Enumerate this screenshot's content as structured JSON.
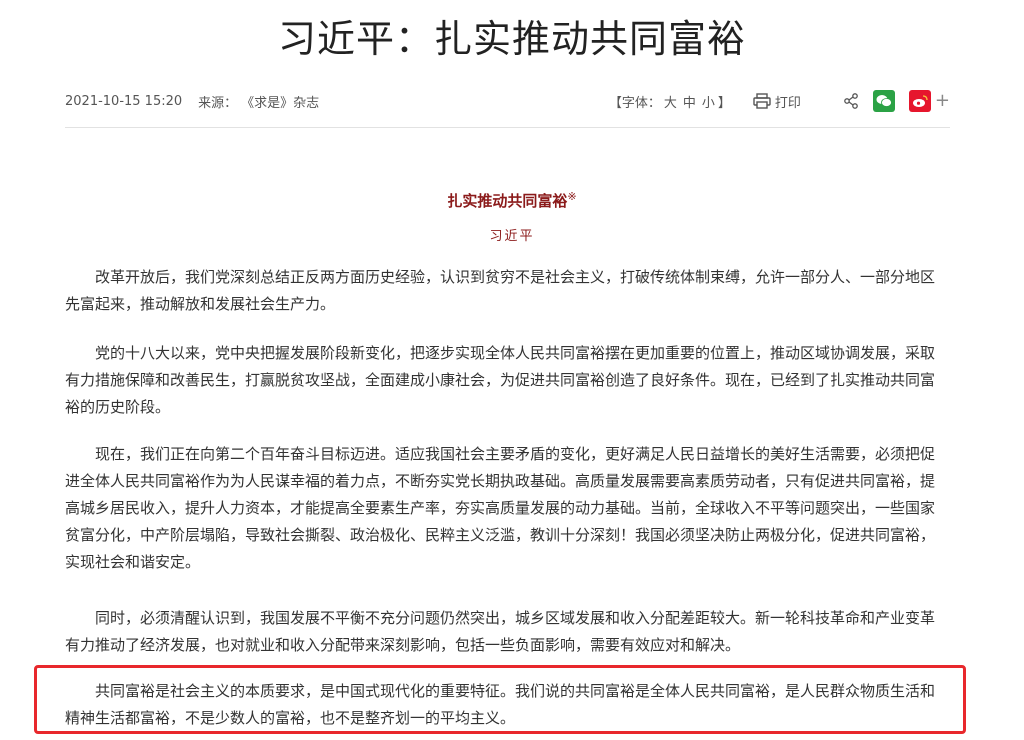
{
  "header": {
    "headline": "习近平：扎实推动共同富裕",
    "date": "2021-10-15 15:20",
    "source_label": "来源：",
    "source": "《求是》杂志",
    "font_bracket_open": "【字体：",
    "font_large": "大",
    "font_medium": "中",
    "font_small": "小",
    "font_bracket_close": "】",
    "print_label": "打印",
    "plus": "+"
  },
  "article": {
    "title": "扎实推动共同富裕",
    "title_mark": "※",
    "author": "习近平",
    "paragraphs": [
      "改革开放后，我们党深刻总结正反两方面历史经验，认识到贫穷不是社会主义，打破传统体制束缚，允许一部分人、一部分地区先富起来，推动解放和发展社会生产力。",
      "党的十八大以来，党中央把握发展阶段新变化，把逐步实现全体人民共同富裕摆在更加重要的位置上，推动区域协调发展，采取有力措施保障和改善民生，打赢脱贫攻坚战，全面建成小康社会，为促进共同富裕创造了良好条件。现在，已经到了扎实推动共同富裕的历史阶段。",
      "现在，我们正在向第二个百年奋斗目标迈进。适应我国社会主要矛盾的变化，更好满足人民日益增长的美好生活需要，必须把促进全体人民共同富裕作为为人民谋幸福的着力点，不断夯实党长期执政基础。高质量发展需要高素质劳动者，只有促进共同富裕，提高城乡居民收入，提升人力资本，才能提高全要素生产率，夯实高质量发展的动力基础。当前，全球收入不平等问题突出，一些国家贫富分化，中产阶层塌陷，导致社会撕裂、政治极化、民粹主义泛滥，教训十分深刻！我国必须坚决防止两极分化，促进共同富裕，实现社会和谐安定。",
      "同时，必须清醒认识到，我国发展不平衡不充分问题仍然突出，城乡区域发展和收入分配差距较大。新一轮科技革命和产业变革有力推动了经济发展，也对就业和收入分配带来深刻影响，包括一些负面影响，需要有效应对和解决。",
      "共同富裕是社会主义的本质要求，是中国式现代化的重要特征。我们说的共同富裕是全体人民共同富裕，是人民群众物质生活和精神生活都富裕，不是少数人的富裕，也不是整齐划一的平均主义。"
    ]
  },
  "icons": [
    "printer-icon",
    "share-icon",
    "wechat-icon",
    "weibo-icon",
    "plus-icon"
  ],
  "colors": {
    "title_red": "#8b1a1a",
    "wechat_green": "#2ba245",
    "weibo_red": "#e6162d",
    "highlight_red": "#e8282c"
  }
}
